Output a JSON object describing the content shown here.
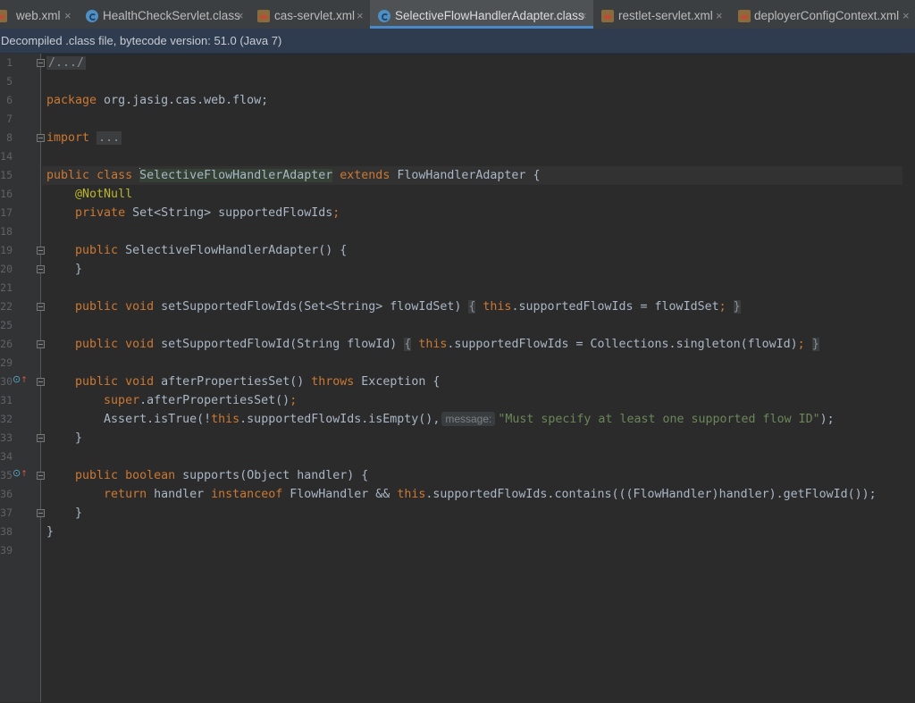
{
  "tabs": [
    {
      "label": "web.xml",
      "type": "xml",
      "active": false
    },
    {
      "label": "HealthCheckServlet.class",
      "type": "class",
      "active": false
    },
    {
      "label": "cas-servlet.xml",
      "type": "xml",
      "active": false
    },
    {
      "label": "SelectiveFlowHandlerAdapter.class",
      "type": "class",
      "active": true
    },
    {
      "label": "restlet-servlet.xml",
      "type": "xml",
      "active": false
    },
    {
      "label": "deployerConfigContext.xml",
      "type": "xml",
      "active": false
    }
  ],
  "tab_close_glyph": "×",
  "banner": {
    "text": "Decompiled .class file, bytecode version: 51.0 (Java 7)"
  },
  "gutter": {
    "line_numbers": [
      "1",
      "5",
      "6",
      "7",
      "8",
      "14",
      "15",
      "16",
      "17",
      "18",
      "19",
      "20",
      "21",
      "22",
      "25",
      "26",
      "29",
      "30",
      "31",
      "32",
      "33",
      "34",
      "35",
      "36",
      "37",
      "38",
      "39"
    ]
  },
  "code": {
    "header_fold": "/.../",
    "package_kw": "package",
    "package_name": " org.jasig.cas.web.flow;",
    "import_kw": "import",
    "import_fold": "...",
    "class_public": "public",
    "class_kw": "class",
    "class_name": "SelectiveFlowHandlerAdapter",
    "extends_kw": "extends",
    "super_name": "FlowHandlerAdapter {",
    "annotation": "@NotNull",
    "field_private": "private",
    "field_decl": " Set<String> supportedFlowIds",
    "semicolon": ";",
    "ctor_public": "public",
    "ctor_sig": " SelectiveFlowHandlerAdapter() {",
    "close_brace": "}",
    "m1_public": "public",
    "m1_void": "void",
    "m1_sig": " setSupportedFlowIds(Set<String> flowIdSet)",
    "m1_open": "{",
    "m1_this": "this",
    "m1_body": ".supportedFlowIds = flowIdSet",
    "m1_semi": ";",
    "m1_close": "}",
    "m2_public": "public",
    "m2_void": "void",
    "m2_sig": " setSupportedFlowId(String flowId)",
    "m2_open": "{",
    "m2_this": "this",
    "m2_body": ".supportedFlowIds = Collections.singleton(flowId)",
    "m2_semi": ";",
    "m2_close": "}",
    "m3_public": "public",
    "m3_void": "void",
    "m3_sig": " afterPropertiesSet() ",
    "m3_throws": "throws",
    "m3_exc": " Exception {",
    "m3_super": "super",
    "m3_super_call": ".afterPropertiesSet()",
    "m3_semi": ";",
    "m3_assert_pre": "Assert.isTrue(!",
    "m3_this": "this",
    "m3_assert_mid": ".supportedFlowIds.isEmpty(),",
    "m3_hint": "message:",
    "m3_string": "\"Must specify at least one supported flow ID\"",
    "m3_tail": ");",
    "m4_public": "public",
    "m4_boolean": "boolean",
    "m4_sig": " supports(Object handler) {",
    "m4_return": "return",
    "m4_mid1": " handler ",
    "m4_instanceof": "instanceof",
    "m4_mid2": " FlowHandler && ",
    "m4_this": "this",
    "m4_tail": ".supportedFlowIds.contains(((FlowHandler)handler).getFlowId());"
  },
  "colors": {
    "background": "#2b2b2b",
    "keyword": "#cc7832",
    "string": "#6a8759",
    "annotation": "#bbb529",
    "plain": "#a9b7c6",
    "active_tab_underline": "#4a88c7"
  }
}
